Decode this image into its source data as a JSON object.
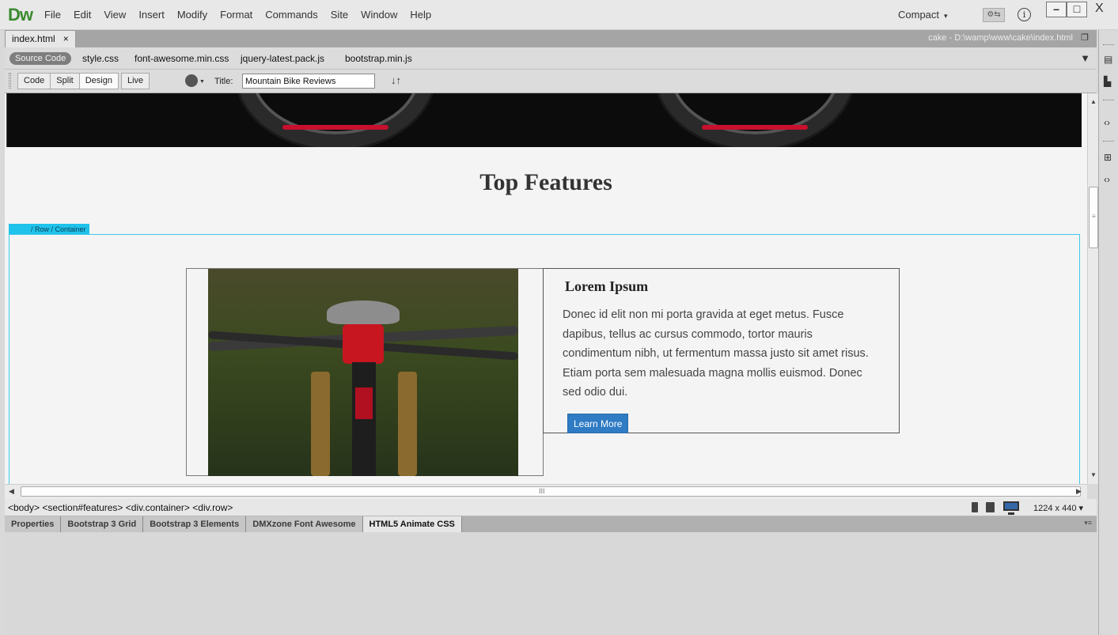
{
  "app": {
    "logo": "Dw",
    "menu": [
      "File",
      "Edit",
      "View",
      "Insert",
      "Modify",
      "Format",
      "Commands",
      "Site",
      "Window",
      "Help"
    ],
    "workspace": "Compact",
    "window_controls": {
      "minimize": "–",
      "maximize": "□",
      "close": "X"
    }
  },
  "document": {
    "tab_name": "index.html",
    "tab_close": "×",
    "path": "cake - D:\\wamp\\www\\cake\\index.html"
  },
  "related_files": {
    "active": "Source Code",
    "files": [
      "style.css",
      "font-awesome.min.css",
      "jquery-latest.pack.js",
      "bootstrap.min.js"
    ]
  },
  "toolbar": {
    "views": [
      "Code",
      "Split",
      "Design",
      "Live"
    ],
    "active_view": "Design",
    "title_label": "Title:",
    "title_value": "Mountain Bike Reviews"
  },
  "canvas": {
    "section_title": "Top Features",
    "row_tag": "/ Row / Container",
    "feature": {
      "heading": "Lorem Ipsum",
      "text": "Donec id elit non mi porta gravida at eget metus. Fusce dapibus, tellus ac cursus commodo, tortor mauris condimentum nibh, ut fermentum massa justo sit amet risus. Etiam porta sem malesuada magna mollis euismod. Donec sed odio dui.",
      "button": "Learn More"
    }
  },
  "statusbar": {
    "tag_selector": "<body> <section#features> <div.container> <div.row>",
    "dimensions": "1224 x 440 ▾"
  },
  "panels": {
    "tabs": [
      "Properties",
      "Bootstrap 3 Grid",
      "Bootstrap 3 Elements",
      "DMXzone Font Awesome",
      "HTML5 Animate CSS"
    ],
    "active_tab": "HTML5 Animate CSS"
  },
  "colors": {
    "row_highlight": "#1fc2ea",
    "button_blue": "#2f7bc4",
    "logo_green": "#3a8a2e"
  }
}
